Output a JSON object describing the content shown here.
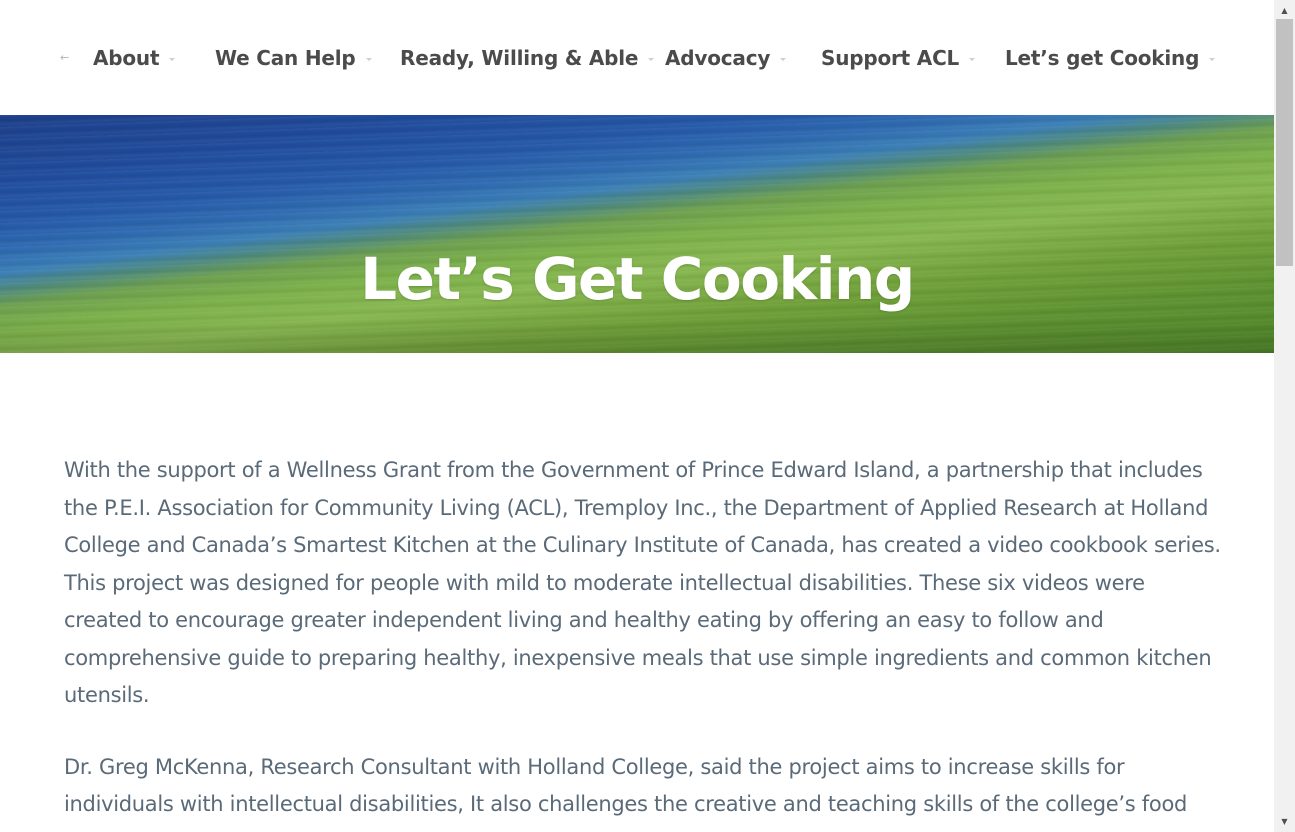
{
  "nav": {
    "items": [
      {
        "label": "About"
      },
      {
        "label": "We Can Help"
      },
      {
        "label": "Ready, Willing & Able"
      },
      {
        "label": "Advocacy"
      },
      {
        "label": "Support ACL"
      },
      {
        "label": "Let’s get Cooking"
      }
    ],
    "leading_arrow": "←"
  },
  "hero": {
    "title": "Let’s Get Cooking"
  },
  "content": {
    "paragraphs": [
      "With the support of a Wellness Grant from the Government of Prince Edward Island, a partnership that includes the P.E.I. Association for Community Living (ACL), Tremploy Inc., the Department of Applied Research at Holland College and Canada’s Smartest Kitchen at the Culinary Institute of Canada, has created a video cookbook series. This project was designed for people with mild to moderate intellectual disabilities. These six videos were created to encourage greater independent living and healthy eating by offering an easy to follow and comprehensive guide to preparing healthy, inexpensive meals that use simple ingredients and common kitchen utensils.",
      "Dr. Greg McKenna, Research Consultant with Holland College, said the project aims to increase skills for individuals with intellectual disabilities, It also challenges the creative and teaching skills of the college’s food"
    ]
  },
  "scrollbar": {
    "up_glyph": "▲",
    "down_glyph": "▼",
    "position": 0.0
  }
}
